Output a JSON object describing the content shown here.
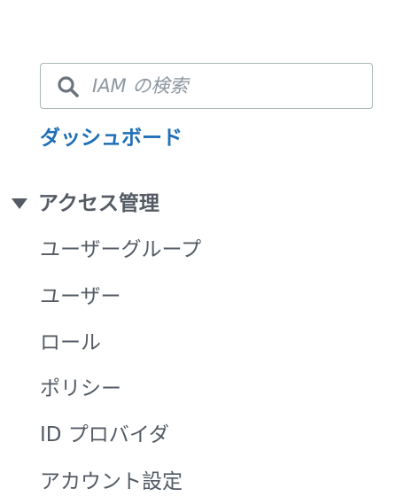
{
  "search": {
    "placeholder": "IAM の検索",
    "value": ""
  },
  "nav": {
    "dashboard_label": "ダッシュボード",
    "access_management": {
      "title": "アクセス管理",
      "expanded": true,
      "items": [
        {
          "label": "ユーザーグループ"
        },
        {
          "label": "ユーザー"
        },
        {
          "label": "ロール"
        },
        {
          "label": "ポリシー"
        },
        {
          "label": "ID プロバイダ"
        },
        {
          "label": "アカウント設定"
        }
      ]
    }
  },
  "colors": {
    "link": "#1f6fb5",
    "text": "#545b64",
    "border": "#aab7b8",
    "placeholder": "#8d969e"
  },
  "icons": {
    "search": "search-icon",
    "caret": "caret-down-icon"
  }
}
